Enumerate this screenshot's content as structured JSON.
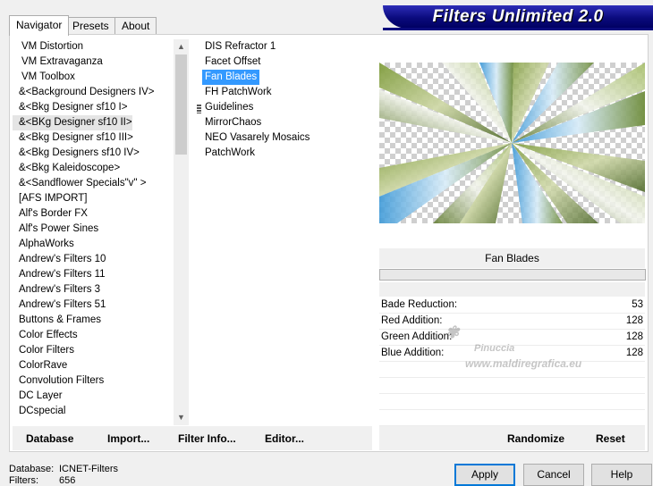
{
  "tabs": [
    {
      "label": "Navigator",
      "active": true
    },
    {
      "label": "Presets",
      "active": false
    },
    {
      "label": "About",
      "active": false
    }
  ],
  "banner": {
    "title": "Filters Unlimited 2.0"
  },
  "categories": [
    "VM Distortion",
    "VM Extravaganza",
    "VM Toolbox",
    "&<Background Designers IV>",
    "&<Bkg Designer sf10 I>",
    "&<BKg Designer sf10 II>",
    "&<Bkg Designer sf10 III>",
    "&<Bkg Designers sf10 IV>",
    "&<Bkg Kaleidoscope>",
    "&<Sandflower Specials\"v\" >",
    "[AFS IMPORT]",
    "Alf's Border FX",
    "Alf's Power Sines",
    "AlphaWorks",
    "Andrew's Filters 10",
    "Andrew's Filters 11",
    "Andrew's Filters 3",
    "Andrew's Filters 51",
    "Buttons & Frames",
    "Color Effects",
    "Color Filters",
    "ColorRave",
    "Convolution Filters",
    "DC Layer",
    "DCspecial"
  ],
  "selected_category": "&<BKg Designer sf10 II>",
  "filters": [
    "DIS Refractor 1",
    "Facet Offset",
    "Fan Blades",
    "FH PatchWork",
    "Guidelines",
    "MirrorChaos",
    "NEO Vasarely Mosaics",
    "PatchWork"
  ],
  "selected_filter": "Fan Blades",
  "preview": {
    "filter_name": "Fan Blades"
  },
  "params": [
    {
      "label": "Bade Reduction:",
      "value": "53"
    },
    {
      "label": "Red Addition:",
      "value": "128"
    },
    {
      "label": "Green Addition:",
      "value": "128"
    },
    {
      "label": "Blue Addition:",
      "value": "128"
    }
  ],
  "left_toolbar": {
    "database": "Database",
    "import": "Import...",
    "filter_info": "Filter Info...",
    "editor": "Editor..."
  },
  "right_toolbar": {
    "randomize": "Randomize",
    "reset": "Reset"
  },
  "status": {
    "database_label": "Database:",
    "database_value": "ICNET-Filters",
    "filters_label": "Filters:",
    "filters_value": "656"
  },
  "buttons": {
    "apply": "Apply",
    "cancel": "Cancel",
    "help": "Help"
  },
  "watermark": {
    "line1": "Pinuccia",
    "line2": "www.maldiregrafica.eu"
  },
  "colors": {
    "banner": "#0a0a7c",
    "selection": "#3399ff",
    "default_button_border": "#0078d7"
  }
}
